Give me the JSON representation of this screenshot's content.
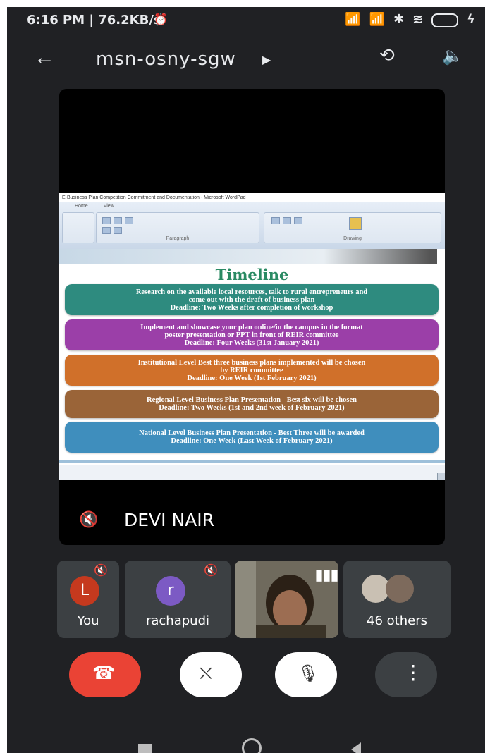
{
  "status_bar": {
    "time_speed": "6:16 PM | 76.2KB/s",
    "icons": [
      "alarm-icon",
      "signal-icon",
      "signal-icon",
      "bluetooth-icon",
      "wifi-icon",
      "battery-icon"
    ]
  },
  "header": {
    "meeting_code": "msn-osny-sgw",
    "icons": [
      "back-arrow-icon",
      "caret-right-icon",
      "switch-camera-icon",
      "speaker-icon"
    ]
  },
  "presentation": {
    "window_title": "E-Business Plan Competition Commitment and Documentation - Microsoft WordPad",
    "ribbon_tabs": [
      "Home",
      "View"
    ],
    "ribbon_groups": [
      "Paragraph",
      "Drawing"
    ],
    "slide_title": "Timeline",
    "items": [
      {
        "lines": [
          "Research on the available local resources, talk to rural entrepreneurs and",
          "come out with the draft of business plan",
          "Deadline: Two Weeks after completion of workshop"
        ],
        "color": "#2e8b7f"
      },
      {
        "lines": [
          "Implement and showcase your plan online/in the campus in the format",
          "poster presentation or PPT in front of REIR committee",
          "Deadline: Four Weeks (31st January 2021)"
        ],
        "color": "#9b3fa8"
      },
      {
        "lines": [
          "Institutional Level Best three business plans implemented will be chosen",
          "by REIR committee",
          "Deadline: One Week (1st February 2021)"
        ],
        "color": "#d0702a"
      },
      {
        "lines": [
          "Regional Level Business Plan Presentation - Best six will be chosen",
          "Deadline: Two Weeks (1st and 2nd week of February 2021)"
        ],
        "color": "#9a6438"
      },
      {
        "lines": [
          "National Level Business Plan Presentation - Best Three will be awarded",
          "Deadline: One Week (Last Week of February 2021)"
        ],
        "color": "#3f8ebd"
      }
    ]
  },
  "speaker": {
    "name": "DEVI NAIR",
    "icon": "mic-muted-icon"
  },
  "participants": {
    "you": {
      "initial": "L",
      "name": "You",
      "avatar_color": "#c5391e"
    },
    "rachapudi": {
      "initial": "r",
      "name": "rachapudi",
      "avatar_color": "#7c5ac4"
    },
    "others": {
      "label": "46 others"
    }
  },
  "controls": {
    "icons": [
      "hang-up-icon",
      "camera-off-icon",
      "mic-off-icon",
      "more-vert-icon"
    ]
  },
  "colors": {
    "background": "#202124",
    "tile": "#3c4043",
    "hangup": "#ea4335"
  }
}
